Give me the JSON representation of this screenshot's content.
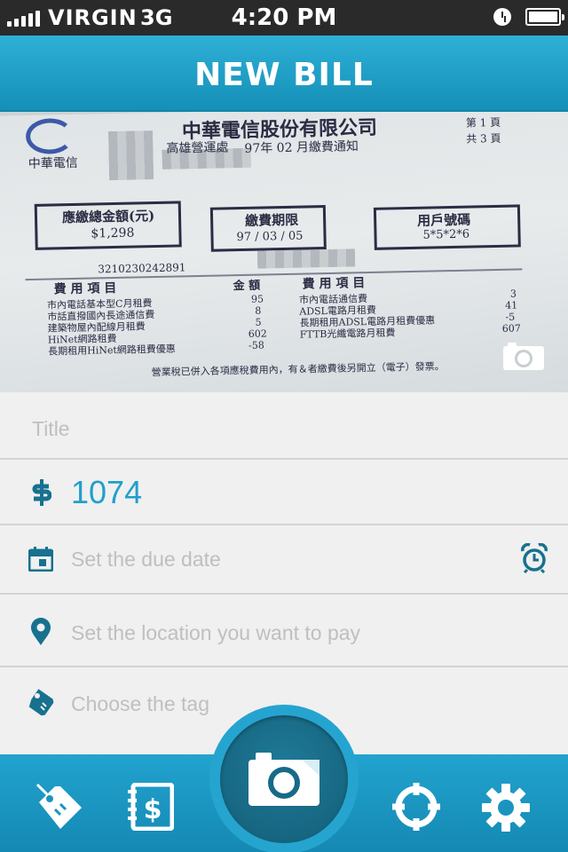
{
  "status_bar": {
    "carrier": "VIRGIN",
    "network": "3G",
    "time": "4:20 PM"
  },
  "header": {
    "title": "NEW BILL"
  },
  "photo": {
    "doc_company": "中華電信股份有限公司",
    "doc_dept": "高雄營運處",
    "doc_notice": "97年 02 月繳費通知",
    "doc_logo_text": "中華電信",
    "doc_page": "第 1 頁",
    "doc_total_pages": "共 3 頁",
    "doc_label_total": "應繳總金額(元)",
    "doc_total_value": "$1,298",
    "doc_label_due": "繳費期限",
    "doc_due_value": "97 / 03 / 05",
    "doc_label_account": "用戶號碼",
    "doc_account_value": "5*5*2*6",
    "doc_receipt_no": "3210230242891",
    "doc_col_header_left": "費  用  項  目",
    "doc_col_header_amount": "金  額",
    "doc_col_header_right": "費  用  項  目",
    "doc_items_left": [
      "市內電話基本型C月租費",
      "市話直撥國內長途通信費",
      "建築物屋內配線月租費",
      "HiNet網路租費",
      "長期租用HiNet網路租費優惠"
    ],
    "doc_amounts_left": [
      "95",
      "8",
      "5",
      "602",
      "-58"
    ],
    "doc_items_right": [
      "市內電話通信費",
      "ADSL電路月租費",
      "長期租用ADSL電路月租費優惠",
      "FTTB光纖電路月租費"
    ],
    "doc_amounts_right": [
      "3",
      "41",
      "-5",
      "607"
    ],
    "doc_footer": "營業稅已併入各項應稅費用內，有＆者繳費後另開立（電子）發票。"
  },
  "form": {
    "title_placeholder": "Title",
    "amount_value": "1074",
    "due_date_placeholder": "Set the due date",
    "location_placeholder": "Set the location you want to pay",
    "tag_placeholder": "Choose the tag"
  },
  "colors": {
    "accent": "#1fa0cc",
    "accent_dark": "#17718f",
    "placeholder": "#bfbfbf"
  },
  "icons": {
    "amount": "dollar-icon",
    "due_date": "calendar-icon",
    "reminder": "alarm-clock-icon",
    "location": "map-pin-icon",
    "tag": "tag-icon",
    "tabs": [
      "tag-icon",
      "bill-icon",
      "camera-icon",
      "target-icon",
      "gear-icon"
    ]
  }
}
